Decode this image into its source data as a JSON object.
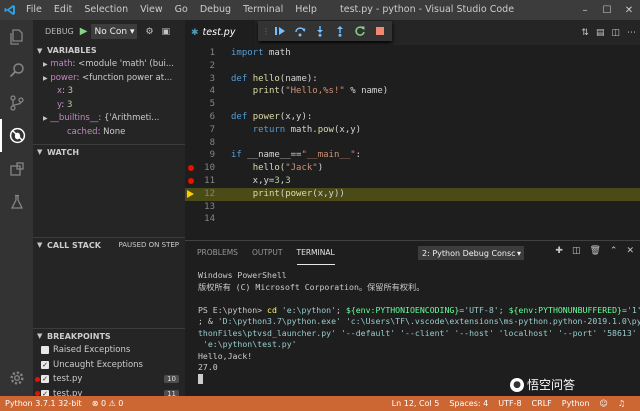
{
  "titlebar": {
    "menu": [
      "File",
      "Edit",
      "Selection",
      "View",
      "Go",
      "Debug",
      "Terminal",
      "Help"
    ],
    "title": "test.py - python - Visual Studio Code"
  },
  "sidebar": {
    "debug_label": "DEBUG",
    "config": "No Con",
    "variables_header": "VARIABLES",
    "variables": [
      {
        "name": "math",
        "value": "<module 'math' (bui..."
      },
      {
        "name": "power",
        "value": "<function power at..."
      },
      {
        "name": "x",
        "value": "3"
      },
      {
        "name": "y",
        "value": "3"
      },
      {
        "name": "__builtins__",
        "value": "{'Arithmeti..."
      },
      {
        "name": "cached",
        "value": "None"
      }
    ],
    "watch_header": "WATCH",
    "callstack_header": "CALL STACK",
    "paused_label": "PAUSED ON STEP",
    "breakpoints_header": "BREAKPOINTS",
    "breakpoints": [
      {
        "label": "Raised Exceptions",
        "checked": false
      },
      {
        "label": "Uncaught Exceptions",
        "checked": true
      },
      {
        "label": "test.py",
        "checked": true,
        "count": "10"
      },
      {
        "label": "test.py",
        "checked": true,
        "count": "11"
      }
    ]
  },
  "editor": {
    "tab": "test.py",
    "lines": [
      {
        "n": "1",
        "segs": [
          [
            "kw",
            "import"
          ],
          [
            "id",
            " math"
          ]
        ]
      },
      {
        "n": "2",
        "segs": []
      },
      {
        "n": "3",
        "segs": [
          [
            "kw",
            "def"
          ],
          [
            "id",
            " "
          ],
          [
            "fn",
            "hello"
          ],
          [
            "id",
            "(name):"
          ]
        ]
      },
      {
        "n": "4",
        "segs": [
          [
            "id",
            "    "
          ],
          [
            "fn",
            "print"
          ],
          [
            "id",
            "("
          ],
          [
            "st",
            "\"Hello,%s!\""
          ],
          [
            "id",
            " % name)"
          ]
        ]
      },
      {
        "n": "5",
        "segs": []
      },
      {
        "n": "6",
        "segs": [
          [
            "kw",
            "def"
          ],
          [
            "id",
            " "
          ],
          [
            "fn",
            "power"
          ],
          [
            "id",
            "(x,y):"
          ]
        ]
      },
      {
        "n": "7",
        "segs": [
          [
            "id",
            "    "
          ],
          [
            "kw",
            "return"
          ],
          [
            "id",
            " math."
          ],
          [
            "fn",
            "pow"
          ],
          [
            "id",
            "(x,y)"
          ]
        ]
      },
      {
        "n": "8",
        "segs": []
      },
      {
        "n": "9",
        "segs": [
          [
            "kw",
            "if"
          ],
          [
            "id",
            " "
          ],
          [
            "id",
            "__name__"
          ],
          [
            "id",
            "=="
          ],
          [
            "st",
            "\"__main__\""
          ],
          [
            "id",
            ":"
          ]
        ]
      },
      {
        "n": "10",
        "segs": [
          [
            "id",
            "    "
          ],
          [
            "fn",
            "hello"
          ],
          [
            "id",
            "("
          ],
          [
            "st",
            "\"Jack\""
          ],
          [
            "id",
            ")"
          ]
        ],
        "bp": true
      },
      {
        "n": "11",
        "segs": [
          [
            "id",
            "    x,y="
          ],
          [
            "nm",
            "3"
          ],
          [
            "id",
            ","
          ],
          [
            "nm",
            "3"
          ]
        ],
        "bp": true
      },
      {
        "n": "12",
        "segs": [
          [
            "id",
            "    "
          ],
          [
            "fn",
            "print"
          ],
          [
            "id",
            "("
          ],
          [
            "fn",
            "power"
          ],
          [
            "id",
            "(x,y))"
          ]
        ],
        "current": true
      },
      {
        "n": "13",
        "segs": []
      },
      {
        "n": "14",
        "segs": []
      }
    ]
  },
  "panel": {
    "tabs": [
      "PROBLEMS",
      "OUTPUT",
      "TERMINAL"
    ],
    "active_tab": "TERMINAL",
    "terminal_select": "2: Python Debug Consc",
    "terminal_lines": [
      [
        [
          "tsp",
          "Windows PowerShell"
        ]
      ],
      [
        [
          "tsp",
          "版权所有 (C) Microsoft Corporation。保留所有权利。"
        ]
      ],
      [
        [
          "tsp",
          ""
        ]
      ],
      [
        [
          "tsp",
          "PS E:\\python> "
        ],
        [
          "tcmd",
          "cd"
        ],
        [
          "targ",
          " 'e:\\python'"
        ],
        [
          "tsp",
          "; "
        ],
        [
          "tvar",
          "${env:PYTHONIOENCODING}"
        ],
        [
          "tsp",
          "="
        ],
        [
          "targ",
          "'UTF-8'"
        ],
        [
          "tsp",
          "; "
        ],
        [
          "tvar",
          "${env:PYTHONUNBUFFERED}"
        ],
        [
          "tsp",
          "="
        ],
        [
          "targ",
          "'1'"
        ]
      ],
      [
        [
          "tsp",
          "; & "
        ],
        [
          "targ",
          "'D:\\python3.7\\python.exe' 'c:\\Users\\TF\\.vscode\\extensions\\ms-python.python-2019.1.0\\py"
        ]
      ],
      [
        [
          "targ",
          "thonFiles\\ptvsd_launcher.py' '--default' '--client' '--host' 'localhost' '--port' '58613'"
        ]
      ],
      [
        [
          "targ",
          " 'e:\\python\\test.py'"
        ]
      ],
      [
        [
          "tsp",
          "Hello,Jack!"
        ]
      ],
      [
        [
          "tsp",
          "27.0"
        ]
      ]
    ]
  },
  "statusbar": {
    "python": "Python 3.7.1 32-bit",
    "errors": "0",
    "warnings": "0",
    "position": "Ln 12, Col 5",
    "spaces": "Spaces: 4",
    "encoding": "UTF-8",
    "eol": "CRLF",
    "language": "Python"
  },
  "watermark": "悟空问答",
  "colors": {
    "statusbar": "#cc6633",
    "breakpoint": "#e51400",
    "current_line_arrow": "#ffcc00"
  }
}
